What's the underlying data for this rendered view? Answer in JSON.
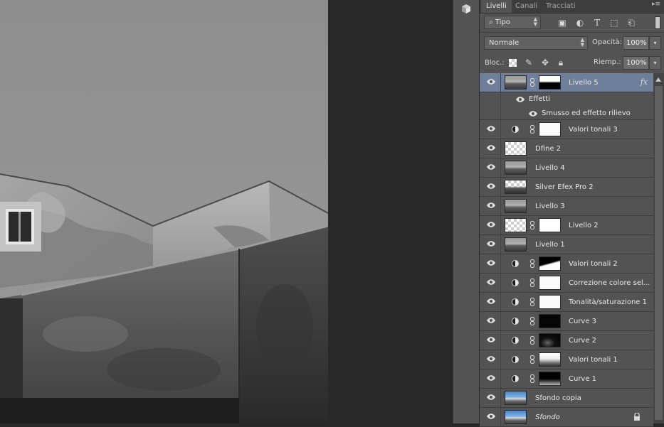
{
  "panel": {
    "tabs": [
      {
        "label": "Livelli",
        "active": true
      },
      {
        "label": "Canali",
        "active": false
      },
      {
        "label": "Tracciati",
        "active": false
      }
    ],
    "filter": {
      "value": "Tipo",
      "icon": "search-icon"
    },
    "blend_mode": "Normale",
    "opacity_label": "Opacità:",
    "opacity_value": "100%",
    "lock_label": "Bloc.:",
    "fill_label": "Riemp.:",
    "fill_value": "100%",
    "layers": [
      {
        "name": "Livello 5",
        "selected": true,
        "fx": "fx"
      },
      {
        "name": "Effetti",
        "sub": true
      },
      {
        "name": "Smusso ed effetto rilievo",
        "sub": true
      },
      {
        "name": "Valori tonali 3"
      },
      {
        "name": "Dfine 2"
      },
      {
        "name": "Livello 4"
      },
      {
        "name": "Silver Efex Pro 2"
      },
      {
        "name": "Livello 3"
      },
      {
        "name": "Livello 2"
      },
      {
        "name": "Livello 1"
      },
      {
        "name": "Valori tonali 2"
      },
      {
        "name": "Correzione colore sel..."
      },
      {
        "name": "Tonalità/saturazione 1"
      },
      {
        "name": "Curve 3"
      },
      {
        "name": "Curve 2"
      },
      {
        "name": "Valori tonali 1"
      },
      {
        "name": "Curve 1"
      },
      {
        "name": "Sfondo copia"
      },
      {
        "name": "Sfondo",
        "locked": true
      }
    ]
  },
  "colors": {
    "selected_layer": "#6e7f99",
    "panel_bg": "#535353",
    "pasteboard": "#282828"
  }
}
